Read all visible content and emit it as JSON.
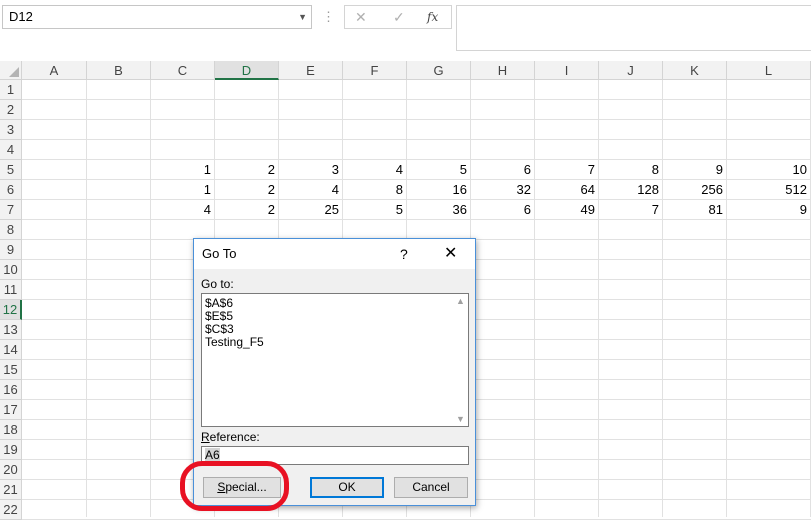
{
  "formula_bar": {
    "name_box": "D12",
    "dropdown_icon": "chevron-down-icon",
    "separator_icon": "vertical-dots-icon",
    "cancel_icon": "close-icon",
    "enter_icon": "check-icon",
    "fx_label": "fx",
    "formula_value": ""
  },
  "sheet": {
    "columns": [
      "A",
      "B",
      "C",
      "D",
      "E",
      "F",
      "G",
      "H",
      "I",
      "J",
      "K",
      "L"
    ],
    "rows": [
      "1",
      "2",
      "3",
      "4",
      "5",
      "6",
      "7",
      "8",
      "9",
      "10",
      "11",
      "12",
      "13",
      "14",
      "15",
      "16",
      "17",
      "18",
      "19",
      "20",
      "21",
      "22"
    ],
    "active_column": "D",
    "active_row": "12",
    "data_rows": [
      {
        "row": "5",
        "values": [
          "1",
          "2",
          "3",
          "4",
          "5",
          "6",
          "7",
          "8",
          "9",
          "10"
        ]
      },
      {
        "row": "6",
        "values": [
          "1",
          "2",
          "4",
          "8",
          "16",
          "32",
          "64",
          "128",
          "256",
          "512"
        ]
      },
      {
        "row": "7",
        "values": [
          "4",
          "2",
          "25",
          "5",
          "36",
          "6",
          "49",
          "7",
          "81",
          "9"
        ]
      }
    ]
  },
  "dialog": {
    "title": "Go To",
    "help": "?",
    "close": "✕",
    "goto_label": "Go to:",
    "goto_items": [
      "$A$6",
      "$E$5",
      "$C$3",
      "Testing_F5"
    ],
    "reference_label_first": "R",
    "reference_label_rest": "eference:",
    "reference_value": "A6",
    "special_first": "S",
    "special_rest": "pecial...",
    "ok": "OK",
    "cancel": "Cancel"
  },
  "annotation": {
    "highlight_color": "#e81123"
  }
}
